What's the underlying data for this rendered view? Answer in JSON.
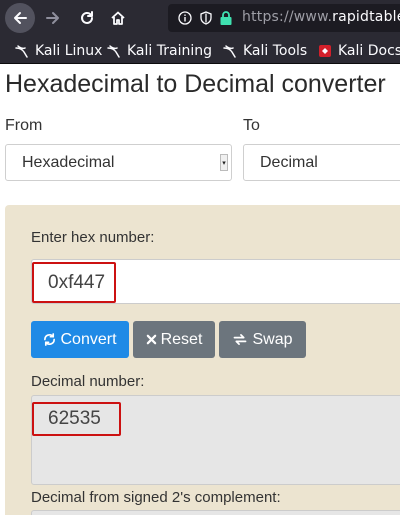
{
  "browser": {
    "url_prefix": "https://www.",
    "url_domain": "rapidtables",
    "bookmarks": [
      {
        "label": "Kali Linux",
        "icon": "kali-dragon-icon"
      },
      {
        "label": "Kali Training",
        "icon": "kali-dragon-icon"
      },
      {
        "label": "Kali Tools",
        "icon": "kali-dragon-icon"
      },
      {
        "label": "Kali Docs",
        "icon": "kali-docs-icon"
      }
    ]
  },
  "page": {
    "title": "Hexadecimal to Decimal converter",
    "from_label": "From",
    "to_label": "To",
    "from_value": "Hexadecimal",
    "to_value": "Decimal",
    "input_label": "Enter hex number:",
    "input_value": "0xf447",
    "buttons": {
      "convert": "Convert",
      "reset": "Reset",
      "swap": "Swap"
    },
    "output_label": "Decimal number:",
    "output_value": "62535",
    "signed_label": "Decimal from signed 2's complement:"
  },
  "colors": {
    "accent": "#1f8ae6",
    "secondary": "#6c757d",
    "panel": "#ece4d0",
    "highlight": "#cc1111",
    "chrome": "#2b2a33"
  }
}
